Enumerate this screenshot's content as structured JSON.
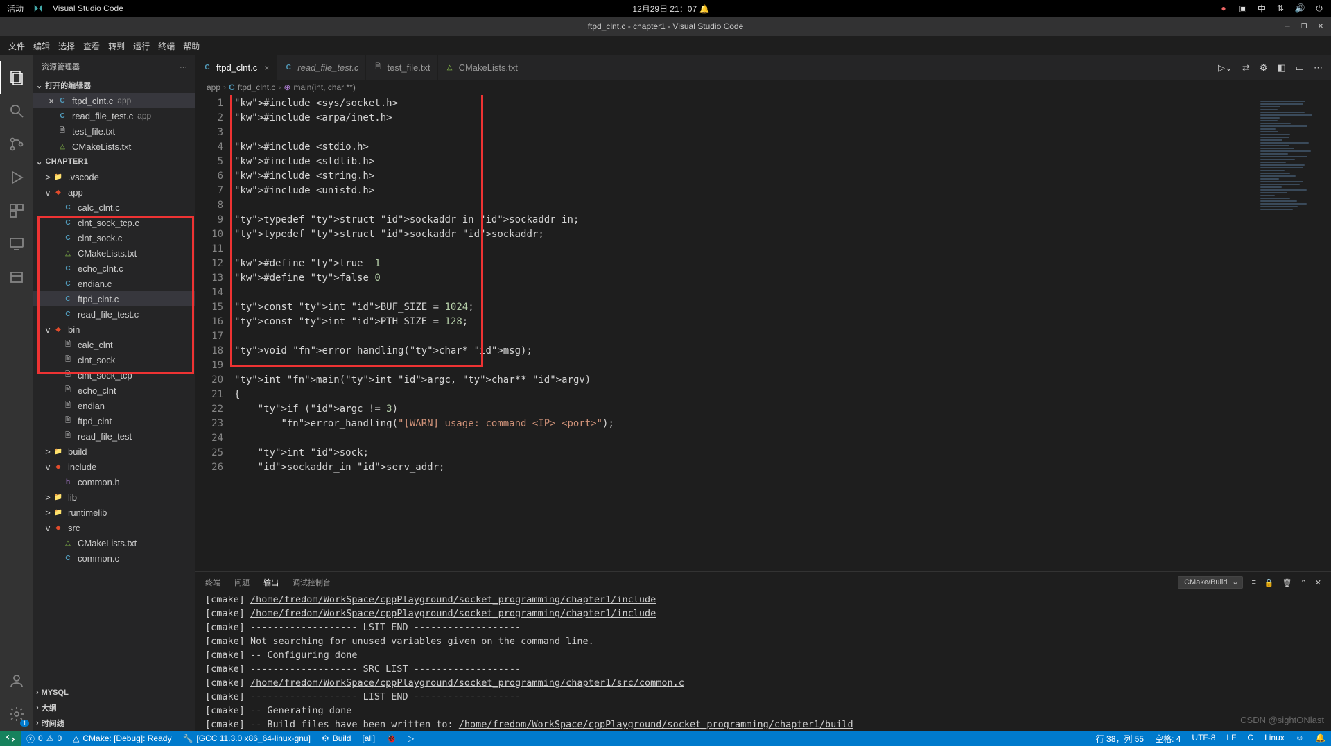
{
  "gnome": {
    "activities": "活动",
    "app": "Visual Studio Code",
    "clock": "12月29日 21：07",
    "lang": "中"
  },
  "title": "ftpd_clnt.c - chapter1 - Visual Studio Code",
  "menu": [
    "文件",
    "编辑",
    "选择",
    "查看",
    "转到",
    "运行",
    "终端",
    "帮助"
  ],
  "explorer": {
    "header": "资源管理器",
    "openEditors": "打开的编辑器",
    "project": "CHAPTER1",
    "outline": "大纲",
    "timeline": "时间线",
    "mysql": "MYSQL",
    "open": [
      {
        "icon": "C",
        "label": "ftpd_clnt.c",
        "dim": "app",
        "close": true,
        "sel": true
      },
      {
        "icon": "C",
        "label": "read_file_test.c",
        "dim": "app"
      },
      {
        "icon": "txt",
        "label": "test_file.txt"
      },
      {
        "icon": "cmake",
        "label": "CMakeLists.txt"
      }
    ],
    "tree": [
      {
        "depth": 0,
        "icon": "folder",
        "label": ".vscode",
        "tw": ">"
      },
      {
        "depth": 0,
        "icon": "git",
        "label": "app",
        "tw": "v"
      },
      {
        "depth": 1,
        "icon": "C",
        "label": "calc_clnt.c"
      },
      {
        "depth": 1,
        "icon": "C",
        "label": "clnt_sock_tcp.c"
      },
      {
        "depth": 1,
        "icon": "C",
        "label": "clnt_sock.c"
      },
      {
        "depth": 1,
        "icon": "cmake",
        "label": "CMakeLists.txt"
      },
      {
        "depth": 1,
        "icon": "C",
        "label": "echo_clnt.c"
      },
      {
        "depth": 1,
        "icon": "C",
        "label": "endian.c"
      },
      {
        "depth": 1,
        "icon": "C",
        "label": "ftpd_clnt.c",
        "sel": true
      },
      {
        "depth": 1,
        "icon": "C",
        "label": "read_file_test.c"
      },
      {
        "depth": 0,
        "icon": "git",
        "label": "bin",
        "tw": "v"
      },
      {
        "depth": 1,
        "icon": "txt",
        "label": "calc_clnt"
      },
      {
        "depth": 1,
        "icon": "txt",
        "label": "clnt_sock"
      },
      {
        "depth": 1,
        "icon": "txt",
        "label": "clnt_sock_tcp"
      },
      {
        "depth": 1,
        "icon": "txt",
        "label": "echo_clnt"
      },
      {
        "depth": 1,
        "icon": "txt",
        "label": "endian"
      },
      {
        "depth": 1,
        "icon": "txt",
        "label": "ftpd_clnt"
      },
      {
        "depth": 1,
        "icon": "txt",
        "label": "read_file_test"
      },
      {
        "depth": 0,
        "icon": "folder",
        "label": "build",
        "tw": ">"
      },
      {
        "depth": 0,
        "icon": "git",
        "label": "include",
        "tw": "v"
      },
      {
        "depth": 1,
        "icon": "h",
        "label": "common.h"
      },
      {
        "depth": 0,
        "icon": "folder",
        "label": "lib",
        "tw": ">"
      },
      {
        "depth": 0,
        "icon": "folder",
        "label": "runtimelib",
        "tw": ">"
      },
      {
        "depth": 0,
        "icon": "git",
        "label": "src",
        "tw": "v"
      },
      {
        "depth": 1,
        "icon": "cmake",
        "label": "CMakeLists.txt"
      },
      {
        "depth": 1,
        "icon": "C",
        "label": "common.c"
      }
    ]
  },
  "tabs": [
    {
      "icon": "C",
      "label": "ftpd_clnt.c",
      "active": true
    },
    {
      "icon": "C",
      "label": "read_file_test.c",
      "italic": true
    },
    {
      "icon": "txt",
      "label": "test_file.txt"
    },
    {
      "icon": "cmake",
      "label": "CMakeLists.txt"
    }
  ],
  "breadcrumbs": [
    "app",
    "ftpd_clnt.c",
    "main(int, char **)"
  ],
  "code_lines": [
    "#include <sys/socket.h>",
    "#include <arpa/inet.h>",
    "",
    "#include <stdio.h>",
    "#include <stdlib.h>",
    "#include <string.h>",
    "#include <unistd.h>",
    "",
    "typedef struct sockaddr_in sockaddr_in;",
    "typedef struct sockaddr sockaddr;",
    "",
    "#define true  1",
    "#define false 0",
    "",
    "const int BUF_SIZE = 1024;",
    "const int PTH_SIZE = 128;",
    "",
    "void error_handling(char* msg);",
    "",
    "int main(int argc, char** argv)",
    "{",
    "    if (argc != 3)",
    "        error_handling(\"[WARN] usage: command <IP> <port>\");",
    "",
    "    int sock;",
    "    sockaddr_in serv_addr;"
  ],
  "panel": {
    "tabs": [
      "终端",
      "问题",
      "输出",
      "调试控制台"
    ],
    "selector": "CMake/Build",
    "lines": [
      {
        "p": "[cmake] ",
        "u": "/home/fredom/WorkSpace/cppPlayground/socket_programming/chapter1/include"
      },
      {
        "p": "[cmake] ",
        "u": "/home/fredom/WorkSpace/cppPlayground/socket_programming/chapter1/include"
      },
      {
        "p": "[cmake] ------------------- LSIT END -------------------"
      },
      {
        "p": "[cmake] Not searching for unused variables given on the command line."
      },
      {
        "p": "[cmake] -- Configuring done"
      },
      {
        "p": "[cmake] ------------------- SRC LIST -------------------"
      },
      {
        "p": "[cmake] ",
        "u": "/home/fredom/WorkSpace/cppPlayground/socket_programming/chapter1/src/common.c"
      },
      {
        "p": "[cmake] ------------------- LIST END -------------------"
      },
      {
        "p": "[cmake] -- Generating done"
      },
      {
        "p": "[cmake] -- Build files have been written to: ",
        "u": "/home/fredom/WorkSpace/cppPlayground/socket_programming/chapter1/build"
      }
    ]
  },
  "status": {
    "errors": "0",
    "warnings": "0",
    "cmake": "CMake: [Debug]: Ready",
    "kit": "[GCC 11.3.0 x86_64-linux-gnu]",
    "build": "Build",
    "target": "[all]",
    "pos": "行 38，列 55",
    "spaces": "空格: 4",
    "enc": "UTF-8",
    "eol": "LF",
    "lang": "C",
    "os": "Linux"
  },
  "watermark": "CSDN @sightONlast"
}
